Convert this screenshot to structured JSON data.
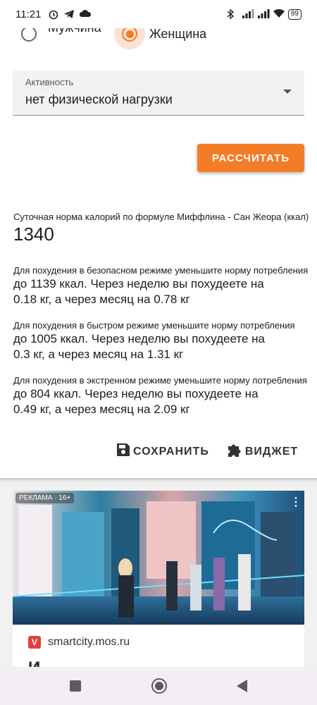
{
  "status_bar": {
    "time": "11:21",
    "battery": "89",
    "icons": [
      "alarm-icon",
      "telegram-icon",
      "cloud-icon",
      "bluetooth-icon",
      "signal-icon",
      "signal-icon",
      "wifi-icon"
    ]
  },
  "gender": {
    "male_label": "Мужчина",
    "female_label": "Женщина",
    "selected": "female"
  },
  "activity": {
    "label": "Активность",
    "value": "нет физической нагрузки"
  },
  "calculate_button": "РАССЧИТАТЬ",
  "result": {
    "title": "Суточная норма калорий по формуле Миффлина - Сан Жеора (ккал)",
    "value": "1340",
    "recommendations": [
      {
        "intro": "Для похудения в безопасном режиме уменьшите норму потребления",
        "line1": "до 1139 ккал. Через неделю вы похудеете на",
        "line2": "0.18 кг, а через месяц на 0.78 кг"
      },
      {
        "intro": "Для похудения в быстром режиме уменьшите норму потребления",
        "line1": "до 1005 ккал. Через неделю вы похудеете на",
        "line2": "0.3 кг, а через месяц на 1.31 кг"
      },
      {
        "intro": "Для похудения в экстренном режиме уменьшите норму потребления",
        "line1": "до 804 ккал. Через неделю вы похудеете на",
        "line2": "0.49 кг, а через месяц на 2.09 кг"
      }
    ]
  },
  "actions": {
    "save_label": "СОХРАНИТЬ",
    "widget_label": "ВИДЖЕТ"
  },
  "ad": {
    "badge": "РЕКЛАМА · 16+",
    "menu": "⋮",
    "source": "smartcity.mos.ru",
    "source_logo": "V",
    "title_stub": "И"
  },
  "colors": {
    "accent": "#f47c26",
    "radio_selected": "#f07c2c"
  }
}
